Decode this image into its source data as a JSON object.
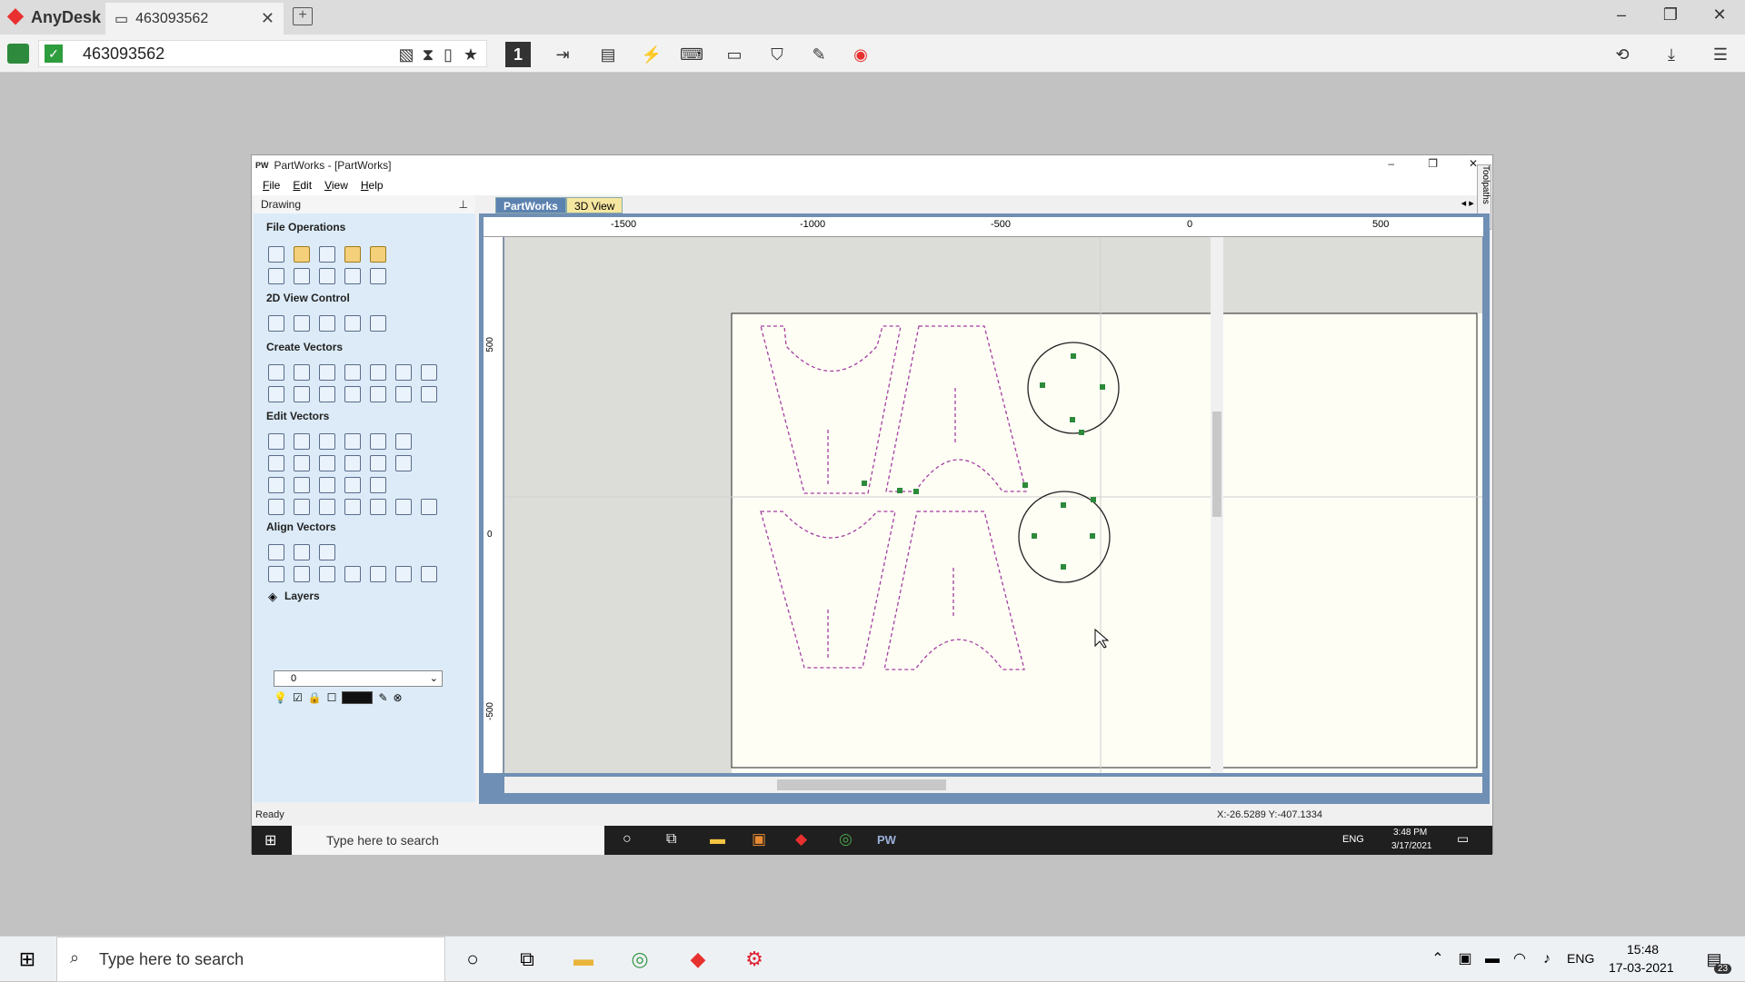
{
  "anydesk": {
    "app_name": "AnyDesk",
    "tab_label": "463093562",
    "address": "463093562",
    "brand_color": "#e8312f"
  },
  "partworks": {
    "title": "PartWorks - [PartWorks]",
    "menu": [
      "File",
      "Edit",
      "View",
      "Help"
    ],
    "panel_title": "Drawing",
    "sections": [
      "File Operations",
      "2D View Control",
      "Create Vectors",
      "Edit Vectors",
      "Align Vectors",
      "Layers"
    ],
    "layer_value": "0",
    "tabs": [
      "PartWorks",
      "3D View"
    ],
    "side_tab": "Toolpaths",
    "ruler_top": [
      "-1500",
      "-1000",
      "-500",
      "0",
      "500"
    ],
    "ruler_left": [
      "500",
      "0",
      "-500"
    ],
    "status_left": "Ready",
    "status_coords": "X:-26.5289 Y:-407.1334"
  },
  "remote_taskbar": {
    "search": "Type here to search",
    "lang": "ENG",
    "time": "3:48 PM",
    "date": "3/17/2021",
    "pw_label": "PW"
  },
  "taskbar": {
    "search": "Type here to search",
    "lang": "ENG",
    "time": "15:48",
    "date": "17-03-2021",
    "notif_count": "23"
  }
}
